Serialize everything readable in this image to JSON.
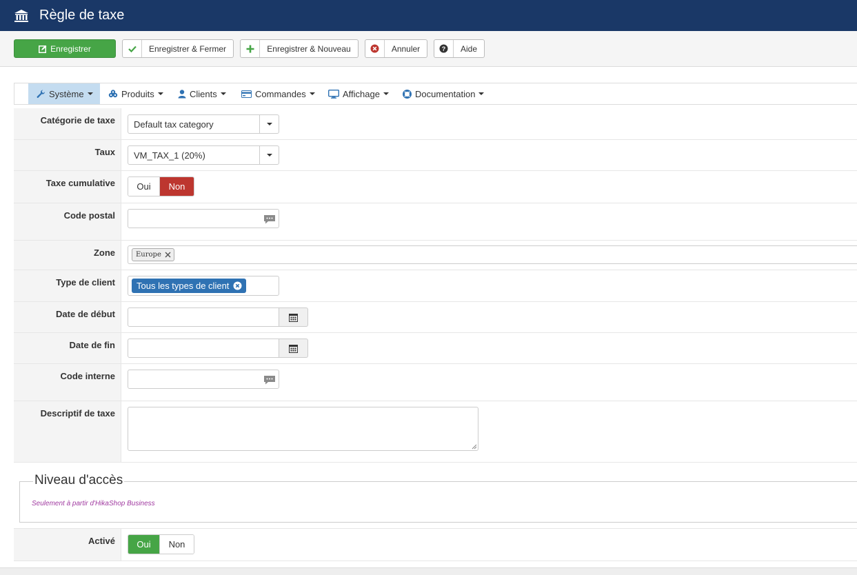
{
  "header": {
    "title": "Règle de taxe",
    "icon": "bank-icon"
  },
  "toolbar": {
    "save_label": "Enregistrer",
    "save_close_label": "Enregistrer & Fermer",
    "save_new_label": "Enregistrer & Nouveau",
    "cancel_label": "Annuler",
    "help_label": "Aide"
  },
  "menu": {
    "items": [
      {
        "label": "Système",
        "icon": "wrench-icon"
      },
      {
        "label": "Produits",
        "icon": "cubes-icon"
      },
      {
        "label": "Clients",
        "icon": "user-icon"
      },
      {
        "label": "Commandes",
        "icon": "credit-card-icon"
      },
      {
        "label": "Affichage",
        "icon": "monitor-icon"
      },
      {
        "label": "Documentation",
        "icon": "lifebuoy-icon"
      }
    ]
  },
  "form": {
    "tax_category": {
      "label": "Catégorie de taxe",
      "value": "Default tax category"
    },
    "rate": {
      "label": "Taux",
      "value": "VM_TAX_1 (20%)"
    },
    "cumulative": {
      "label": "Taxe cumulative",
      "yes": "Oui",
      "no": "Non",
      "selected": "Non"
    },
    "postal_code": {
      "label": "Code postal",
      "value": ""
    },
    "zone": {
      "label": "Zone",
      "tag": "Europe"
    },
    "client_type": {
      "label": "Type de client",
      "tag": "Tous les types de client"
    },
    "start_date": {
      "label": "Date de début",
      "value": ""
    },
    "end_date": {
      "label": "Date de fin",
      "value": ""
    },
    "internal_code": {
      "label": "Code interne",
      "value": ""
    },
    "description": {
      "label": "Descriptif de taxe",
      "value": ""
    }
  },
  "access": {
    "legend": "Niveau d'accès",
    "note": "Seulement à partir d'HikaShop Business"
  },
  "active": {
    "label": "Activé",
    "yes": "Oui",
    "no": "Non",
    "selected": "Oui"
  },
  "colors": {
    "header_bg": "#1a3867",
    "save_green": "#46a546",
    "no_red": "#bd362f",
    "menu_active": "#c4dcf0",
    "tag_blue": "#2f72b3",
    "note_purple": "#a03aa0"
  }
}
